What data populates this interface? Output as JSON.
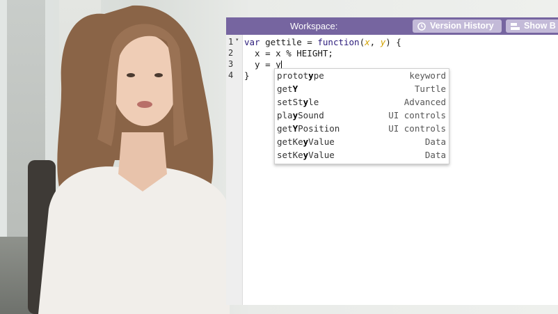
{
  "header": {
    "title": "Workspace:",
    "version_history_label": "Version History",
    "show_label": "Show B"
  },
  "editor": {
    "line_numbers": [
      "1",
      "2",
      "3",
      "4"
    ],
    "lines": [
      {
        "kw": "var",
        "name": " gettile = ",
        "kw2": "function",
        "open": "(",
        "p1": "x",
        "comma": ", ",
        "p2": "y",
        "close": ") {"
      },
      {
        "text": "  x = x % HEIGHT;"
      },
      {
        "text": "  y = y"
      },
      {
        "text": "}"
      }
    ]
  },
  "autocomplete": {
    "items": [
      {
        "pre": "protot",
        "match": "y",
        "post": "pe",
        "category": "keyword"
      },
      {
        "pre": "get",
        "match": "Y",
        "post": "",
        "category": "Turtle"
      },
      {
        "pre": "setSt",
        "match": "y",
        "post": "le",
        "category": "Advanced"
      },
      {
        "pre": "pla",
        "match": "y",
        "post": "Sound",
        "category": "UI controls"
      },
      {
        "pre": "get",
        "match": "Y",
        "post": "Position",
        "category": "UI controls"
      },
      {
        "pre": "getKe",
        "match": "y",
        "post": "Value",
        "category": "Data"
      },
      {
        "pre": "setKe",
        "match": "y",
        "post": "Value",
        "category": "Data"
      }
    ]
  },
  "colors": {
    "header_bg": "#7665a0",
    "button_bg": "#c3bad8",
    "param_color": "#d4a300",
    "keyword_color": "#2a1a7a"
  }
}
